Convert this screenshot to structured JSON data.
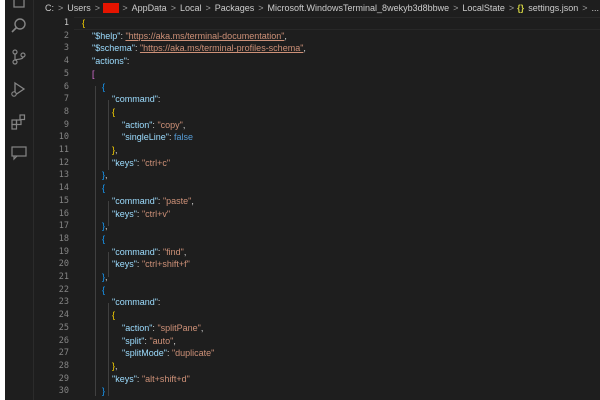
{
  "breadcrumb": {
    "root": "C:",
    "users": "Users",
    "appdata": "AppData",
    "local": "Local",
    "packages": "Packages",
    "terminal_pkg": "Microsoft.WindowsTerminal_8wekyb3d8bbwe",
    "localstate": "LocalState",
    "json_icon": "{}",
    "file": "settings.json",
    "more": "...",
    "separator": ">"
  },
  "activity_bar": {
    "icons": [
      "explorer-icon",
      "search-icon",
      "source-control-icon",
      "run-debug-icon",
      "extensions-icon",
      "remote-explorer-icon"
    ]
  },
  "editor": {
    "current_line": 1,
    "line_numbers": [
      "1",
      "2",
      "3",
      "4",
      "5",
      "6",
      "7",
      "8",
      "9",
      "10",
      "11",
      "12",
      "13",
      "14",
      "15",
      "16",
      "17",
      "18",
      "19",
      "20",
      "21",
      "22",
      "23",
      "24",
      "25",
      "26",
      "27",
      "28",
      "29",
      "30"
    ],
    "tokens": {
      "help_key": "\"$help\"",
      "help_val": "\"https://aka.ms/terminal-documentation\"",
      "schema_key": "\"$schema\"",
      "schema_val": "\"https://aka.ms/terminal-profiles-schema\"",
      "actions_key": "\"actions\"",
      "command_key": "\"command\"",
      "action_key": "\"action\"",
      "copy_val": "\"copy\"",
      "singleline_key": "\"singleLine\"",
      "false_val": "false",
      "keys_key": "\"keys\"",
      "ctrl_c": "\"ctrl+c\"",
      "paste_val": "\"paste\"",
      "ctrl_v": "\"ctrl+v\"",
      "find_val": "\"find\"",
      "ctrl_shift_f": "\"ctrl+shift+f\"",
      "splitpane_val": "\"splitPane\"",
      "split_key": "\"split\"",
      "auto_val": "\"auto\"",
      "splitmode_key": "\"splitMode\"",
      "duplicate_val": "\"duplicate\"",
      "alt_shift_d": "\"alt+shift+d\""
    }
  },
  "colors": {
    "background": "#1e1e1e",
    "key": "#9cdcfe",
    "string": "#ce9178",
    "keyword": "#569cd6",
    "bracket_gold": "#ffd700",
    "bracket_purple": "#da70d6",
    "bracket_blue": "#179fff",
    "redaction": "#e51400"
  }
}
